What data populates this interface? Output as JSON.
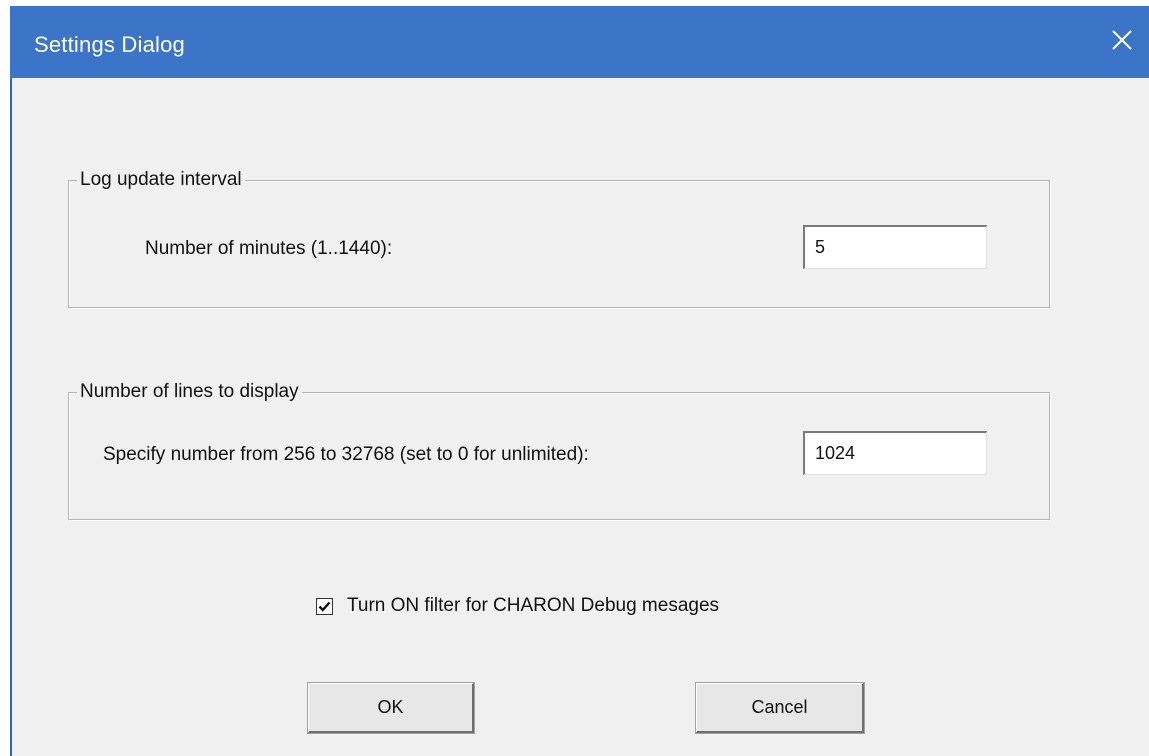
{
  "window": {
    "title": "Settings Dialog",
    "close_icon": "close-icon"
  },
  "log_update_group": {
    "legend": "Log update interval",
    "label": "Number of minutes (1..1440):",
    "value": "5"
  },
  "lines_group": {
    "legend": "Number of lines to display",
    "label": "Specify number from 256 to 32768 (set to 0 for unlimited):",
    "value": "1024"
  },
  "filter_checkbox": {
    "label": "Turn ON filter for CHARON Debug mesages",
    "checked": true
  },
  "buttons": {
    "ok_label": "OK",
    "cancel_label": "Cancel"
  },
  "colors": {
    "titlebar": "#3c75c8",
    "dialog_bg": "#f0f0f0"
  }
}
